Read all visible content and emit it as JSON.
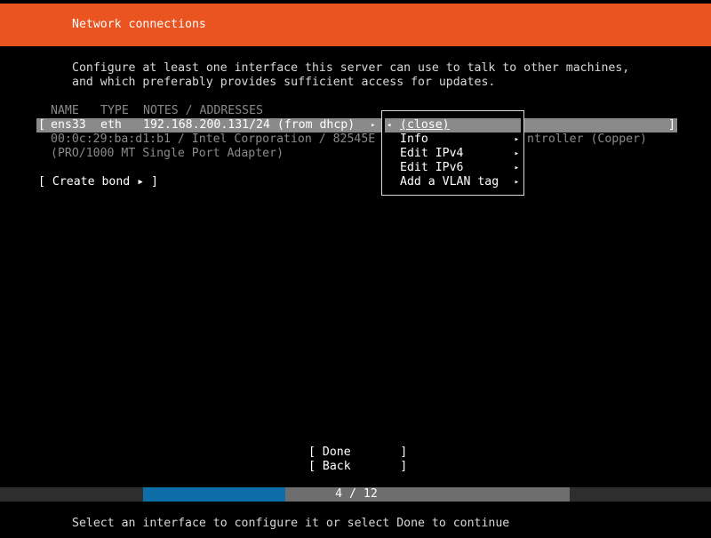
{
  "header": {
    "title": "Network connections"
  },
  "intro": {
    "line1": "Configure at least one interface this server can use to talk to other machines,",
    "line2": "and which preferably provides sufficient access for updates."
  },
  "table": {
    "col_name": "NAME",
    "col_type": "TYPE",
    "col_notes": "NOTES / ADDRESSES",
    "row": {
      "open_bracket": "[",
      "name": "ens33",
      "type": "eth",
      "address": "192.168.200.131/24 (from dhcp)",
      "close_bracket": "]"
    },
    "detail1_left": "00:0c:29:ba:d1:b1 / Intel Corporation / 82545E",
    "detail1_right": "ntroller (Copper)",
    "detail2": "(PRO/1000 MT Single Port Adapter)"
  },
  "create_bond": "[ Create bond ▸ ]",
  "popup": {
    "items": [
      {
        "label": "(close)"
      },
      {
        "label": "Info"
      },
      {
        "label": "Edit IPv4"
      },
      {
        "label": "Edit IPv6"
      },
      {
        "label": "Add a VLAN tag"
      }
    ]
  },
  "buttons": {
    "done": "[ Done       ]",
    "back": "[ Back       ]"
  },
  "progress": {
    "text": "4 / 12",
    "current": 4,
    "total": 12,
    "fraction": 0.333
  },
  "footer": {
    "text": "Select an interface to configure it or select Done to continue"
  },
  "colors": {
    "header": "#e95420",
    "selection": "#8a8a8a",
    "progress": "#0e6fa8"
  }
}
